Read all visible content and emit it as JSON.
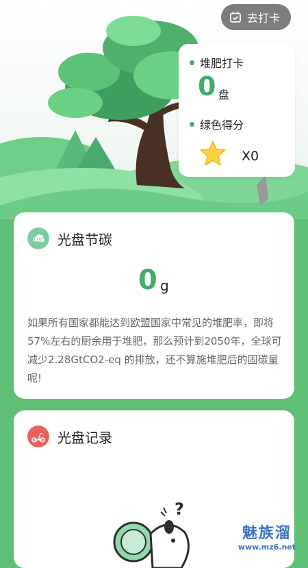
{
  "header": {
    "checkin_label": "去打卡",
    "calendar_icon": "calendar-icon"
  },
  "stats": {
    "compost_label": "堆肥打卡",
    "compost_count": "0",
    "compost_unit": "盘",
    "score_label": "绿色得分",
    "score_value": "X0",
    "star_icon": "star-icon"
  },
  "carbon_card": {
    "title": "光盘节碳",
    "value": "0",
    "unit": "g",
    "description": "如果所有国家都能达到欧盟国家中常见的堆肥率，即将57%左右的厨余用于堆肥，那么预计到2050年，全球可减少2.28GtCO2-eq 的排放，还不算施堆肥后的固碳量呢!"
  },
  "record_card": {
    "title": "光盘记录"
  },
  "watermark": {
    "name": "魅族溜",
    "url": "www.mz6.net"
  },
  "colors": {
    "accent": "#3fae6a",
    "background": "#5fbf75",
    "button": "#7d7d7d",
    "record_icon": "#e8615a"
  }
}
